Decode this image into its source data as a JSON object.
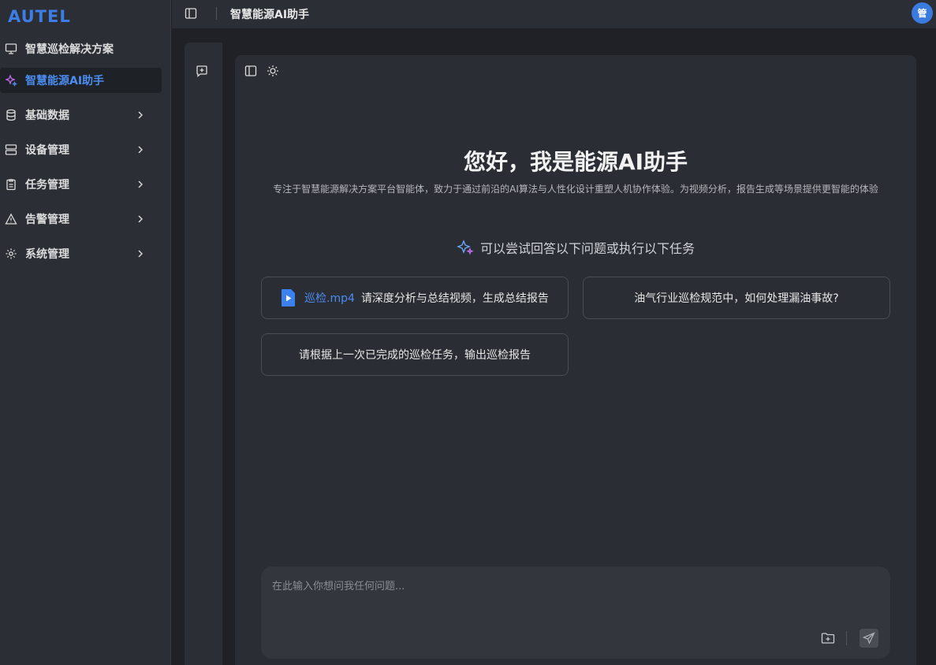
{
  "brand": "AUTEL",
  "header": {
    "title": "智慧能源AI助手",
    "avatar_text": "管"
  },
  "sidebar": {
    "items": [
      {
        "label": "智慧巡检解决方案",
        "icon": "presentation-icon",
        "active": false
      },
      {
        "label": "智慧能源AI助手",
        "icon": "sparkles-icon",
        "active": true
      },
      {
        "label": "基础数据",
        "icon": "database-icon",
        "active": false
      },
      {
        "label": "设备管理",
        "icon": "server-icon",
        "active": false
      },
      {
        "label": "任务管理",
        "icon": "clipboard-icon",
        "active": false
      },
      {
        "label": "告警管理",
        "icon": "warning-icon",
        "active": false
      },
      {
        "label": "系统管理",
        "icon": "gear-icon",
        "active": false
      }
    ]
  },
  "main": {
    "greeting": "您好，我是能源AI助手",
    "subtitle": "专注于智慧能源解决方案平台智能体，致力于通过前沿的AI算法与人性化设计重塑人机协作体验。为视频分析，报告生成等场景提供更智能的体验",
    "hint": "可以尝试回答以下问题或执行以下任务",
    "suggestions": [
      {
        "file": "巡检.mp4",
        "text": "请深度分析与总结视频，生成总结报告"
      },
      {
        "text": "油气行业巡检规范中，如何处理漏油事故?"
      },
      {
        "text": "请根据上一次已完成的巡检任务，输出巡检报告"
      }
    ]
  },
  "input": {
    "placeholder": "在此输入你想问我任何问题..."
  },
  "colors": {
    "accent": "#4a8cf0",
    "background": "#1f2126",
    "panel": "#2a2d33"
  }
}
